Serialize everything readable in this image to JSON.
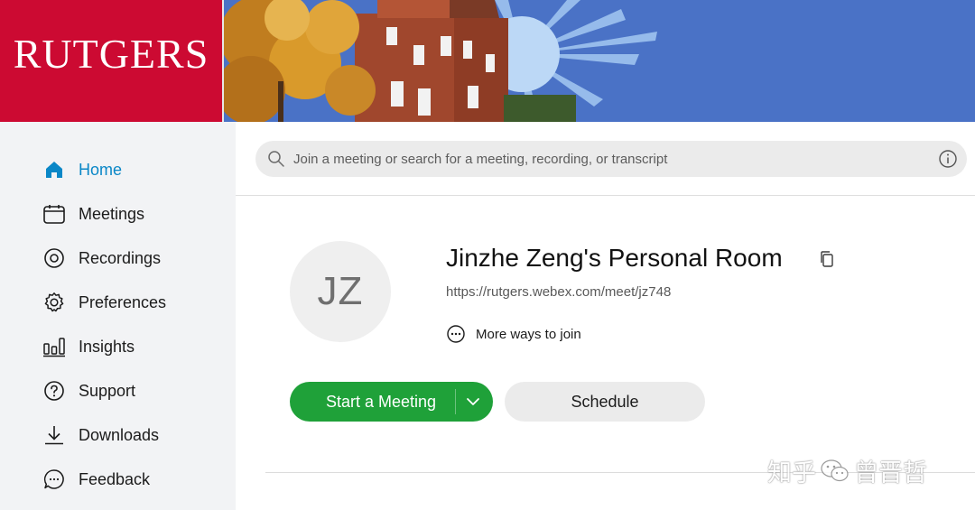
{
  "header": {
    "logo_text": "RUTGERS",
    "brand_color": "#cc0a32"
  },
  "sidebar": {
    "items": [
      {
        "label": "Home",
        "icon": "home-icon",
        "active": true
      },
      {
        "label": "Meetings",
        "icon": "calendar-icon",
        "active": false
      },
      {
        "label": "Recordings",
        "icon": "record-icon",
        "active": false
      },
      {
        "label": "Preferences",
        "icon": "gear-icon",
        "active": false
      },
      {
        "label": "Insights",
        "icon": "bar-chart-icon",
        "active": false
      },
      {
        "label": "Support",
        "icon": "help-icon",
        "active": false
      },
      {
        "label": "Downloads",
        "icon": "download-icon",
        "active": false
      },
      {
        "label": "Feedback",
        "icon": "feedback-icon",
        "active": false
      }
    ],
    "active_color": "#0a87c7"
  },
  "search": {
    "placeholder": "Join a meeting or search for a meeting, recording, or transcript"
  },
  "room": {
    "initials": "JZ",
    "title": "Jinzhe Zeng's Personal Room",
    "url": "https://rutgers.webex.com/meet/jz748",
    "more_ways_label": "More ways to join"
  },
  "actions": {
    "start_label": "Start a Meeting",
    "schedule_label": "Schedule",
    "start_color": "#1fa139"
  },
  "watermark": {
    "left_text": "知乎",
    "right_text": "曾晋哲"
  }
}
